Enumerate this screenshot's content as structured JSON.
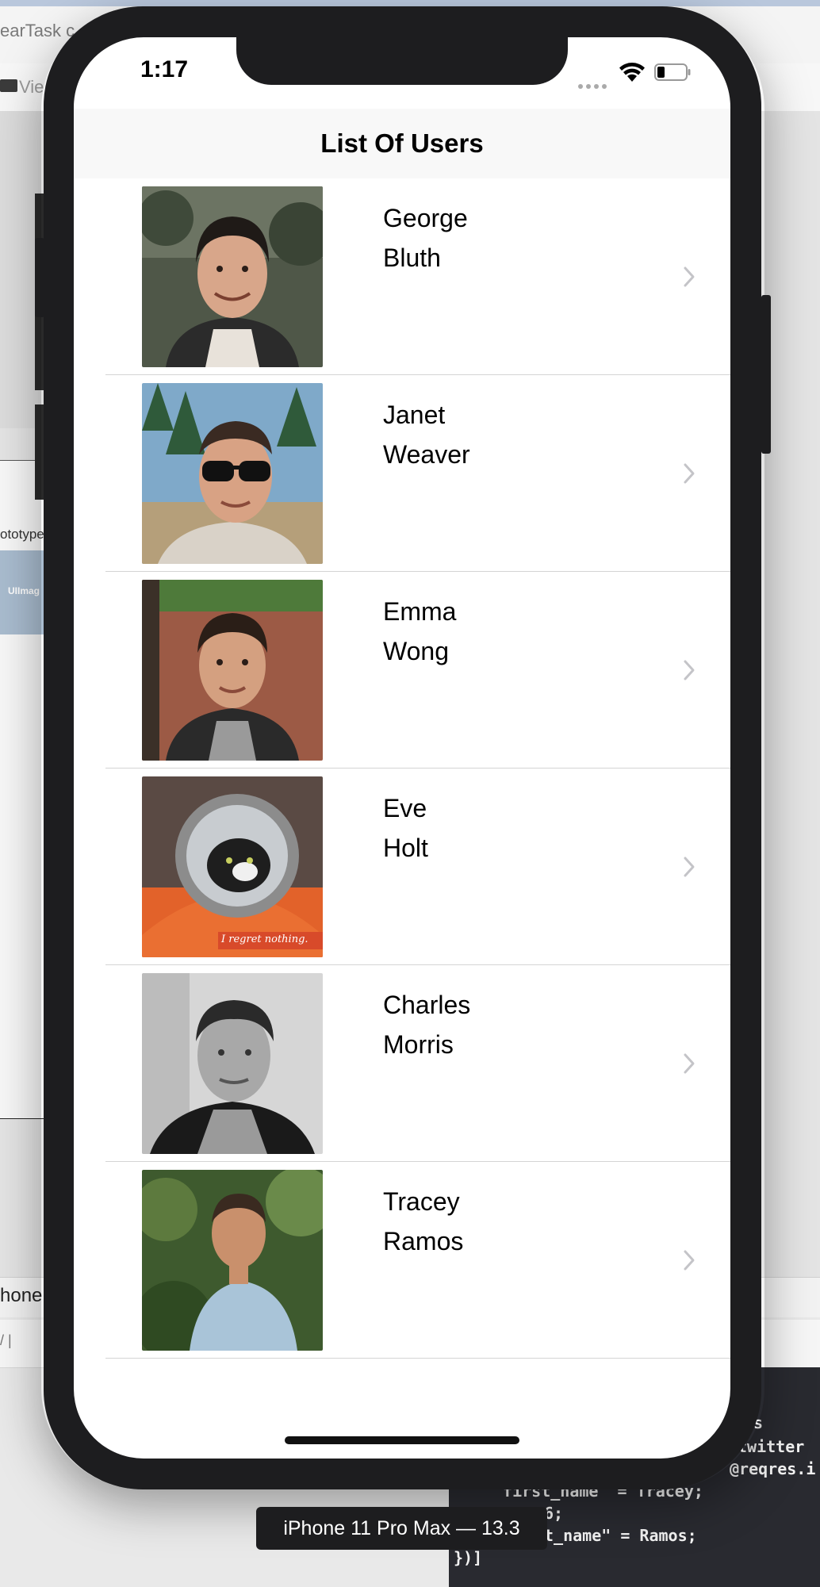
{
  "xcode": {
    "breadcrumb": "earTask c",
    "tab_label": "Vie",
    "prototype_label": "ototype",
    "uiimage_label": "UIImag",
    "device_footer_text": "hone",
    "debug_glyph": "/ | ",
    "console_lines": [
      "s",
      "twitter",
      "@reqres.i",
      "\"first_name\" = Tracey;",
      "6;",
      "t_name\" = Ramos;",
      "})]"
    ]
  },
  "device": {
    "label": "iPhone 11 Pro Max — 13.3",
    "status_bar": {
      "time": "1:17",
      "signal_icon": "signal-dots-icon",
      "wifi_icon": "wifi-icon",
      "battery_icon": "battery-low-icon"
    }
  },
  "nav": {
    "title": "List Of Users"
  },
  "users": [
    {
      "first_name": "George",
      "last_name": "Bluth",
      "avatar": "avatar-photo-1"
    },
    {
      "first_name": "Janet",
      "last_name": "Weaver",
      "avatar": "avatar-photo-2"
    },
    {
      "first_name": "Emma",
      "last_name": "Wong",
      "avatar": "avatar-photo-3"
    },
    {
      "first_name": "Eve",
      "last_name": "Holt",
      "avatar": "avatar-photo-4",
      "avatar_caption": "I regret nothing."
    },
    {
      "first_name": "Charles",
      "last_name": "Morris",
      "avatar": "avatar-photo-5"
    },
    {
      "first_name": "Tracey",
      "last_name": "Ramos",
      "avatar": "avatar-photo-6"
    }
  ]
}
